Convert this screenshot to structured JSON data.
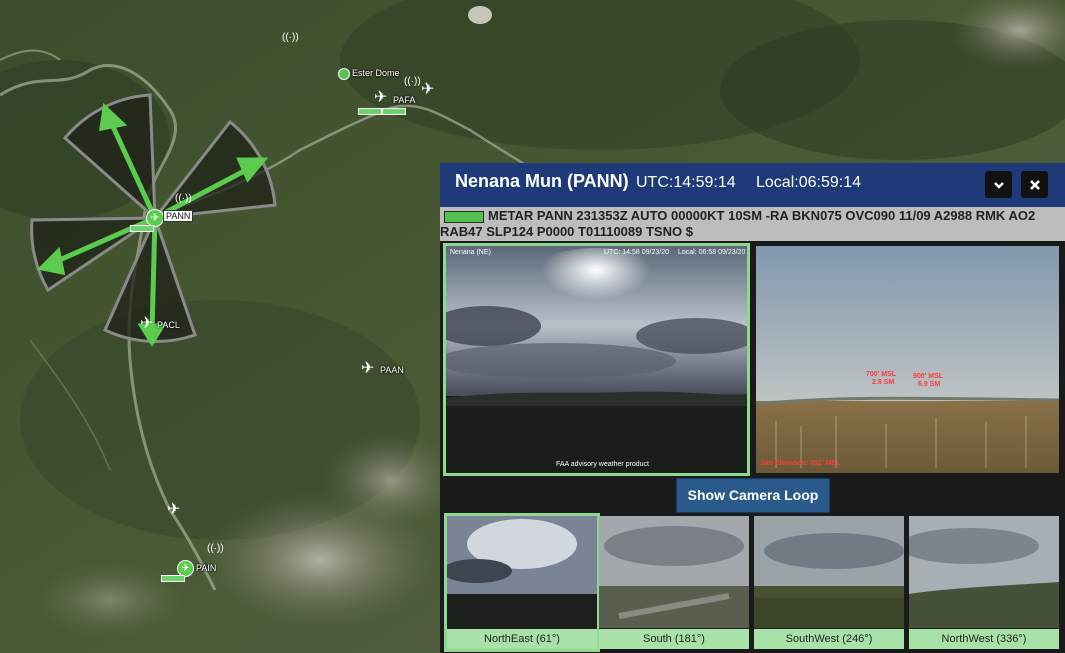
{
  "map": {
    "places": {
      "ester_dome": "Ester Dome",
      "pafa": "PAFA",
      "pann": "PANN",
      "pacl": "PACL",
      "paan": "PAAN",
      "pain": "PAIN"
    }
  },
  "panel": {
    "title": "Nenana Mun (PANN)",
    "utc": "UTC:14:59:14",
    "local": "Local:06:59:14",
    "metar": "METAR PANN 231353Z AUTO 00000KT 10SM -RA BKN075 OVC090 11/09 A2988 RMK AO2 RAB47 SLP124 P0000 T01110089 TSNO $",
    "cam_main": {
      "station": "Nenana (NE)",
      "timestamp": "UTC: 14:58 09/23/20",
      "local": "Local: 06:58 09/23/20",
      "watermark": "FAA advisory weather product"
    },
    "cam_ref": {
      "marker1": "700' MSL",
      "marker1_dist": "2.8 SM",
      "marker2": "900' MSL",
      "marker2_dist": "6.9 SM",
      "elevation": "Site Elevation: 351' MSL"
    },
    "loop_button": "Show Camera Loop",
    "thumbs": [
      {
        "label": "NorthEast (61°)"
      },
      {
        "label": "South (181°)"
      },
      {
        "label": "SouthWest (246°)"
      },
      {
        "label": "NorthWest (336°)"
      }
    ]
  },
  "colors": {
    "header_bg": "#1e3a78",
    "accent_green": "#52c152",
    "button_blue": "#2a5a8c"
  }
}
